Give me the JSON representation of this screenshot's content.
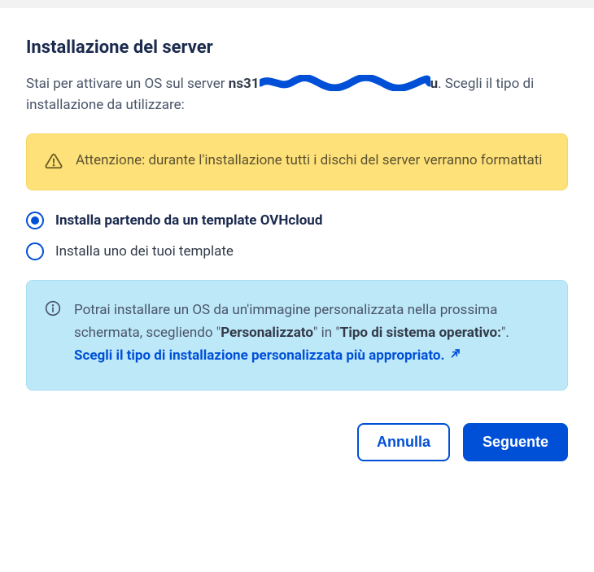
{
  "title": "Installazione del server",
  "intro": {
    "prefix": "Stai per attivare un OS sul server ",
    "server_visible": "ns31",
    "server_hidden_suffix": "u",
    "suffix": ". Scegli il tipo di installazione da utilizzare:"
  },
  "warning": {
    "text": "Attenzione: durante l'installazione tutti i dischi del server verranno formattati"
  },
  "options": [
    {
      "label": "Installa partendo da un template OVHcloud",
      "checked": true
    },
    {
      "label": "Installa uno dei tuoi template",
      "checked": false
    }
  ],
  "info": {
    "text_before": "Potrai installare un OS da un'immagine personalizzata nella prossima schermata, scegliendo \"",
    "bold1": "Personalizzato",
    "text_mid1": "\" in \"",
    "bold2": "Tipo di sistema operativo:",
    "text_mid2": "\". ",
    "link_text": "Scegli il tipo di installazione personalizzata più appropriato."
  },
  "buttons": {
    "cancel": "Annulla",
    "next": "Seguente"
  }
}
